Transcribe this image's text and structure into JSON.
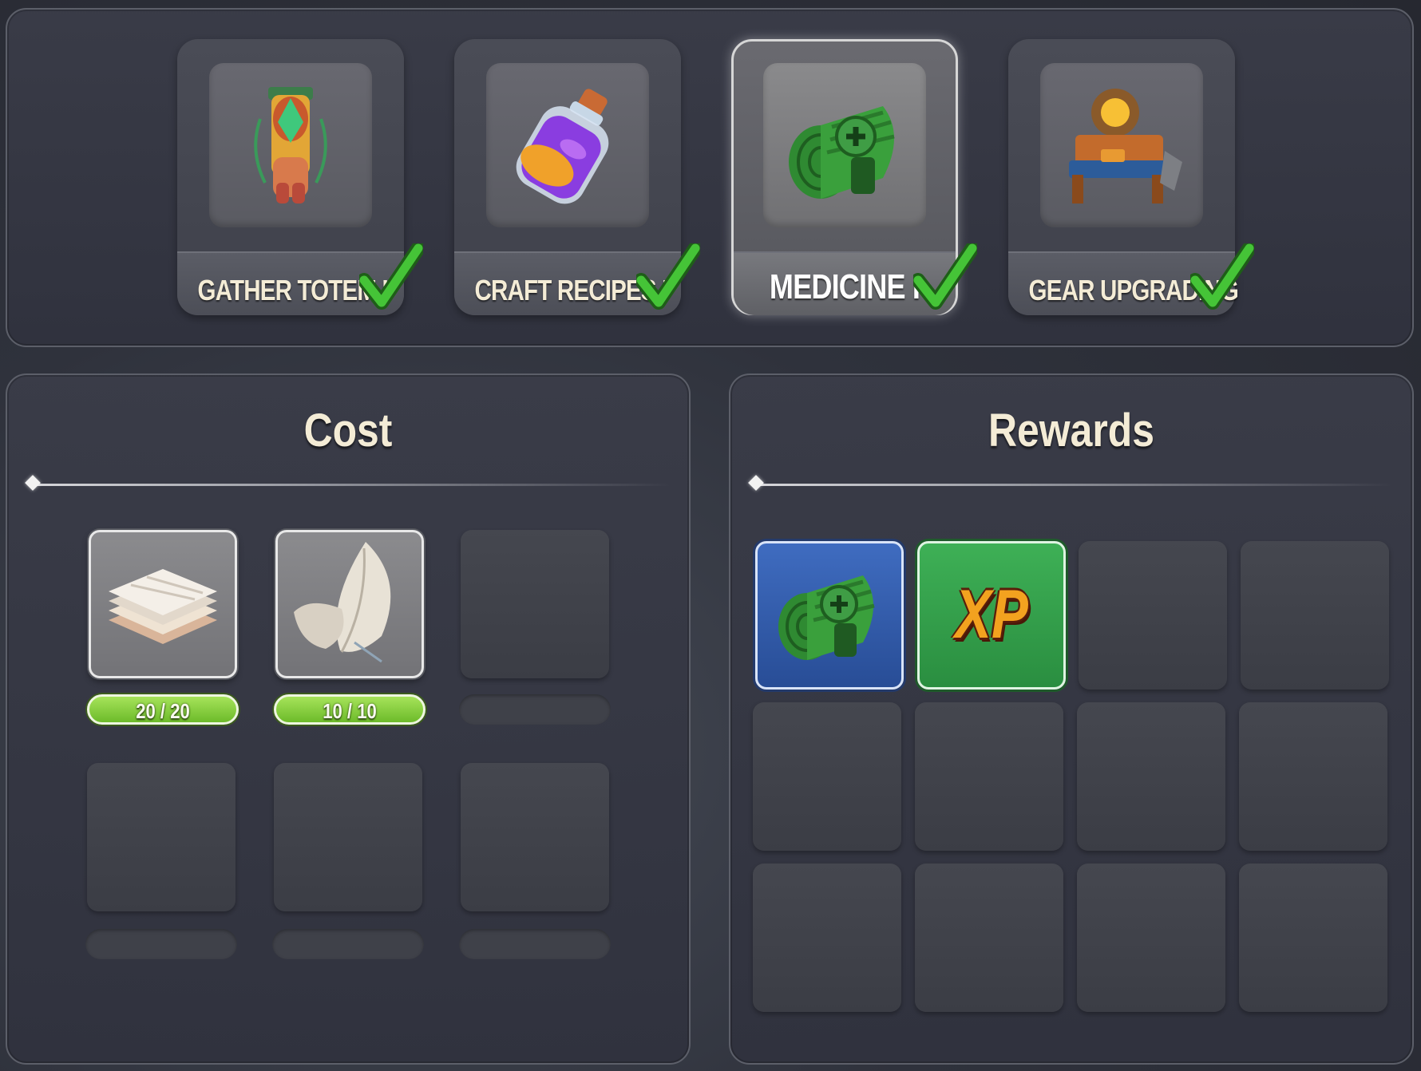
{
  "tabs": [
    {
      "label": "GATHER TOTEM I",
      "icon": "totem-icon",
      "completed": true,
      "active": false
    },
    {
      "label": "CRAFT RECIPES I",
      "icon": "potion-bottle-icon",
      "completed": true,
      "active": false
    },
    {
      "label": "MEDICINE I",
      "icon": "bandage-roll-icon",
      "completed": true,
      "active": true
    },
    {
      "label": "GEAR UPGRADING",
      "icon": "crafting-workbench-icon",
      "completed": true,
      "active": false
    }
  ],
  "cost": {
    "title": "Cost",
    "items": [
      {
        "icon": "cloth-stack-icon",
        "count": "20 / 20"
      },
      {
        "icon": "feather-icon",
        "count": "10 / 10"
      }
    ]
  },
  "rewards": {
    "title": "Rewards",
    "items": [
      {
        "icon": "bandage-roll-icon",
        "frame": "blue"
      },
      {
        "icon": "xp-icon",
        "text": "XP",
        "frame": "green"
      }
    ]
  },
  "colors": {
    "progress_green": "#8fd246",
    "reward_blue": "#3a64b6",
    "reward_green": "#34a04c",
    "title_cream": "#f4ecd6",
    "check_green": "#3fbf2f"
  }
}
